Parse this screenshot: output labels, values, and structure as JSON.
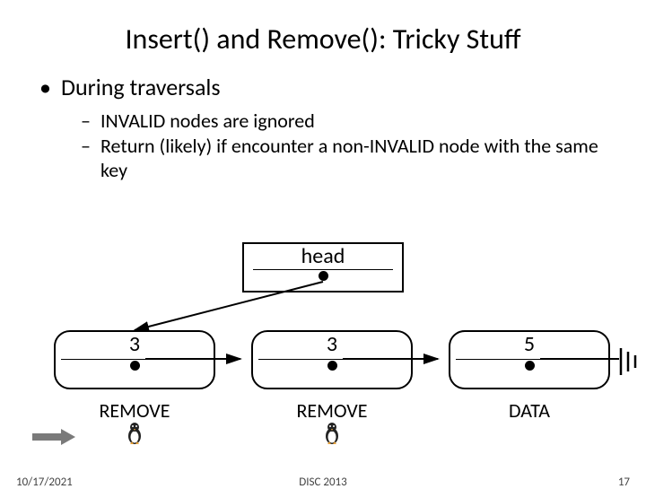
{
  "title": "Insert() and Remove(): Tricky Stuff",
  "bullets": {
    "main": "During traversals",
    "sub1": "INVALID nodes are ignored",
    "sub2": "Return (likely) if encounter a non-INVALID node with the same key"
  },
  "diagram": {
    "head_label": "head",
    "nodes": [
      {
        "key": "3",
        "state": "REMOVE",
        "has_penguin": true
      },
      {
        "key": "3",
        "state": "REMOVE",
        "has_penguin": true
      },
      {
        "key": "5",
        "state": "DATA",
        "has_penguin": false
      }
    ]
  },
  "footer": {
    "date": "10/17/2021",
    "venue": "DISC 2013",
    "page": "17"
  }
}
